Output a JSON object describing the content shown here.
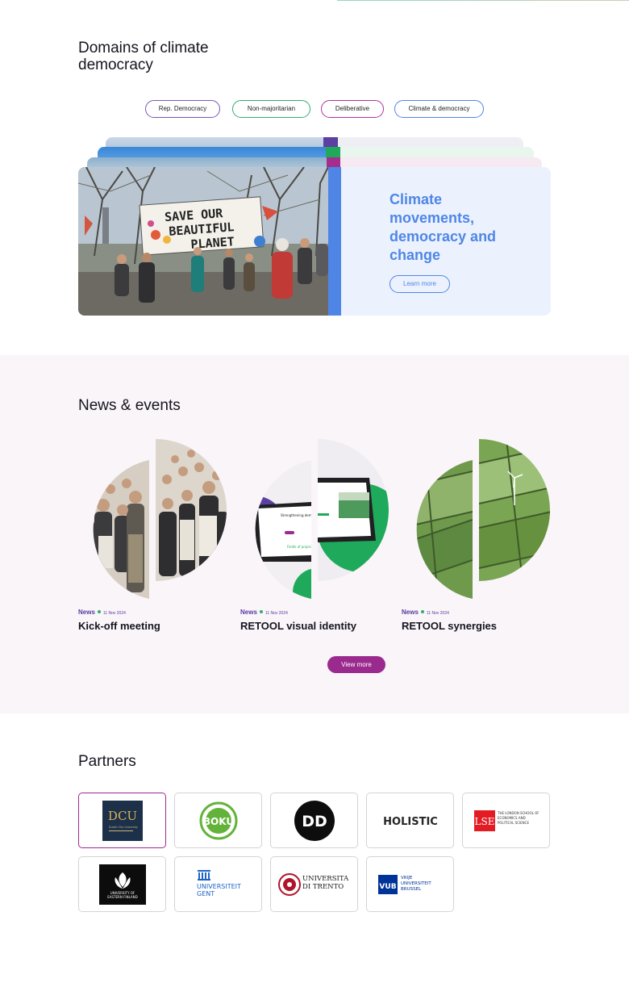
{
  "domains": {
    "title": "Domains of climate democracy",
    "pills": [
      "Rep. Democracy",
      "Non-majoritarian",
      "Deliberative",
      "Climate & democracy"
    ],
    "card": {
      "title": "Climate movements, democracy and change",
      "button": "Learn more",
      "banner_text": [
        "SAVE OUR",
        "BEAUTIFUL",
        "PLANET"
      ]
    },
    "colors": {
      "purple": "#5b3fa2",
      "green": "#1fa95b",
      "magenta": "#a42d8d",
      "blue": "#4f86e6"
    }
  },
  "news": {
    "title": "News & events",
    "items": [
      {
        "tag": "News",
        "date": "11 Nov 2024",
        "title": "Kick-off meeting"
      },
      {
        "tag": "News",
        "date": "11 Nov 2024",
        "title": "RETOOL visual identity",
        "screen_text": "Strengthening democratic governance for climate transitions",
        "screen_sub": "Fields of project"
      },
      {
        "tag": "News",
        "date": "11 Nov 2024",
        "title": "RETOOL synergies"
      }
    ],
    "view_more": "View more"
  },
  "partners": {
    "title": "Partners",
    "logos": [
      {
        "name": "DCU",
        "sub": "Dublin City University"
      },
      {
        "name": "BOKU"
      },
      {
        "name": "DD"
      },
      {
        "name": "HOLISTIC"
      },
      {
        "name": "LSE",
        "sub": "THE LONDON SCHOOL OF ECONOMICS AND POLITICAL SCIENCE"
      },
      {
        "name": "UNIVERSITY OF EASTERN FINLAND"
      },
      {
        "name": "UNIVERSITEIT GENT"
      },
      {
        "name": "UNIVERSITÀ DI TRENTO"
      },
      {
        "name": "VUB",
        "sub": "VRIJE UNIVERSITEIT BRUSSEL"
      }
    ]
  }
}
